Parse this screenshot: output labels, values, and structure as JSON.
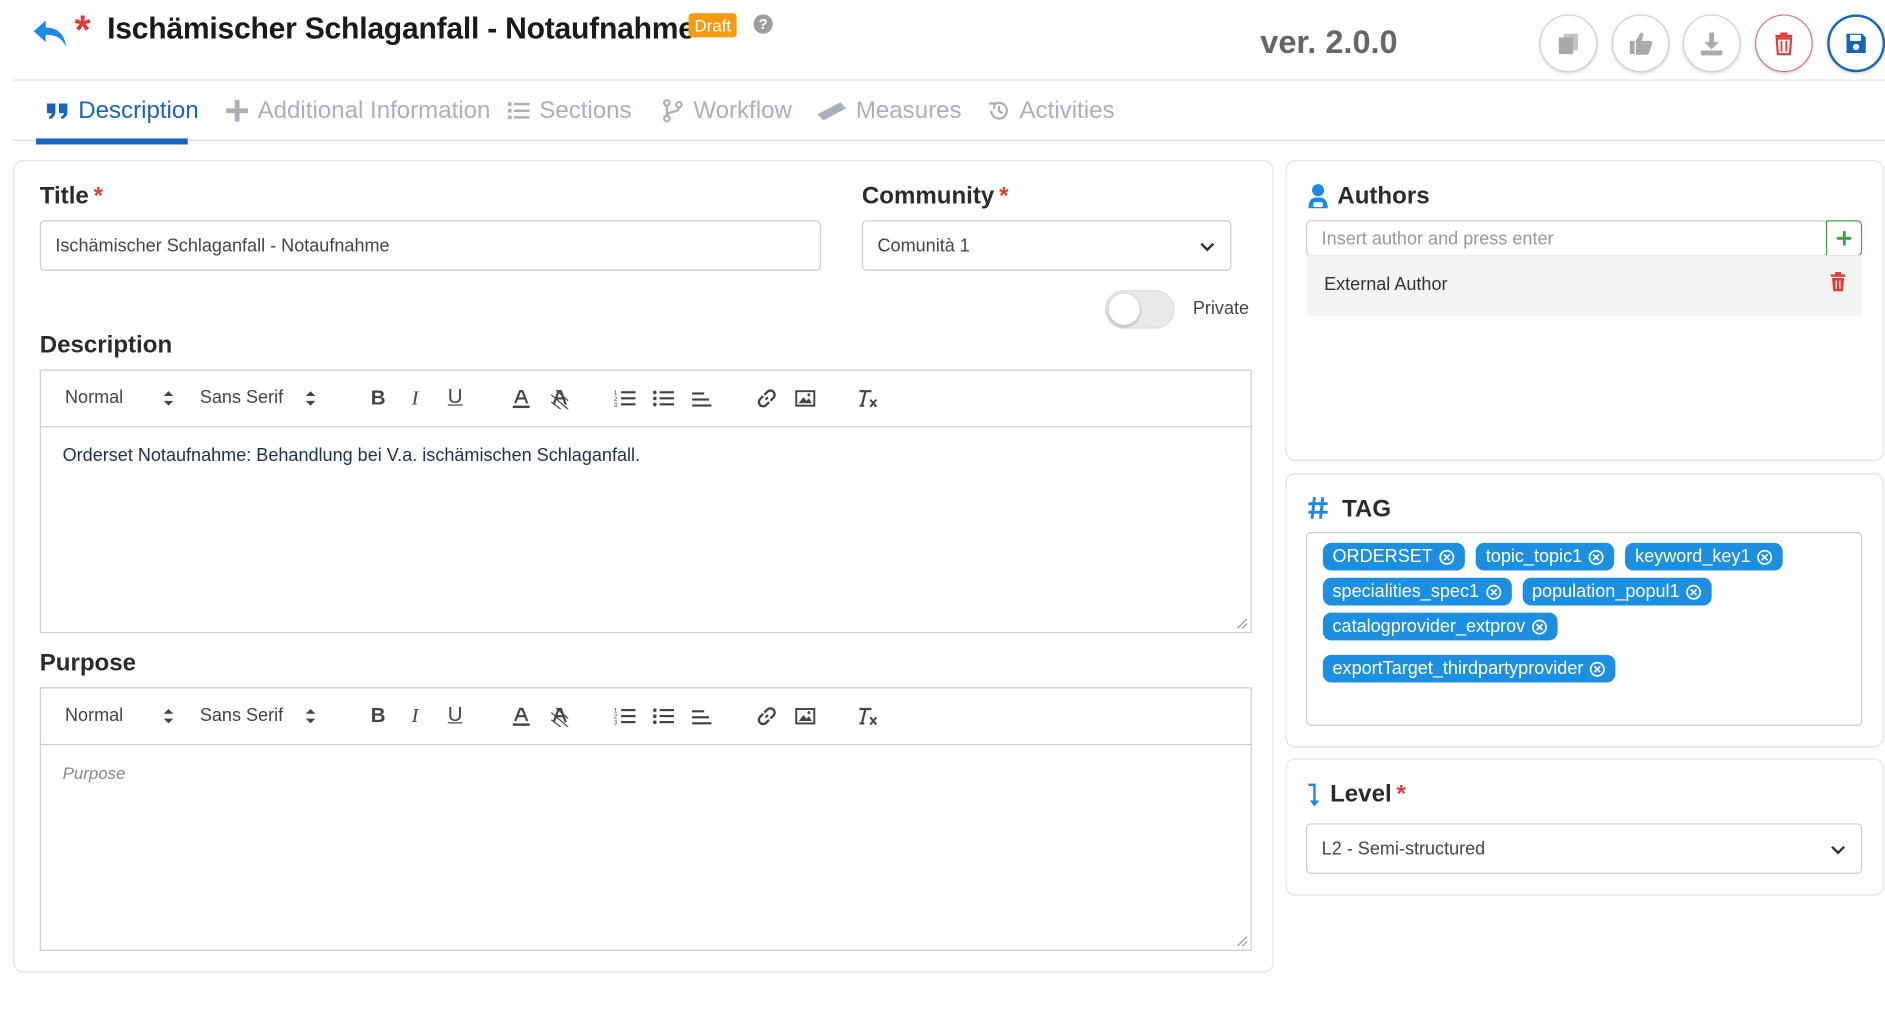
{
  "header": {
    "title": "Ischämischer Schlaganfall - Notaufnahme",
    "status_badge": "Draft",
    "help": "?",
    "version": "ver. 2.0.0"
  },
  "tabs": [
    {
      "label": "Description",
      "icon": "quote-icon",
      "active": true
    },
    {
      "label": "Additional Information",
      "icon": "plus-icon"
    },
    {
      "label": "Sections",
      "icon": "list-icon"
    },
    {
      "label": "Workflow",
      "icon": "branch-icon"
    },
    {
      "label": "Measures",
      "icon": "ruler-icon"
    },
    {
      "label": "Activities",
      "icon": "history-icon"
    }
  ],
  "form": {
    "title_label": "Title",
    "title_value": "Ischämischer Schlaganfall - Notaufnahme",
    "community_label": "Community",
    "community_value": "Comunità 1",
    "private_label": "Private",
    "private_on": false,
    "description_label": "Description",
    "description_text": "Orderset Notaufnahme: Behandlung bei V.a. ischämischen Schlaganfall.",
    "purpose_label": "Purpose",
    "purpose_placeholder": "Purpose",
    "toolbar": {
      "format": "Normal",
      "font": "Sans Serif"
    }
  },
  "authors": {
    "label": "Authors",
    "input_placeholder": "Insert author and press enter",
    "items": [
      "External Author"
    ]
  },
  "tags": {
    "label": "TAG",
    "items": [
      "ORDERSET",
      "topic_topic1",
      "keyword_key1",
      "specialities_spec1",
      "population_popul1",
      "catalogprovider_extprov",
      "exportTarget_thirdpartyprovider"
    ]
  },
  "level": {
    "label": "Level",
    "value": "L2 - Semi-structured"
  },
  "colors": {
    "accent": "#1565c0",
    "danger": "#e53935",
    "draft": "#f39c12",
    "chip": "#1d8fe1"
  }
}
